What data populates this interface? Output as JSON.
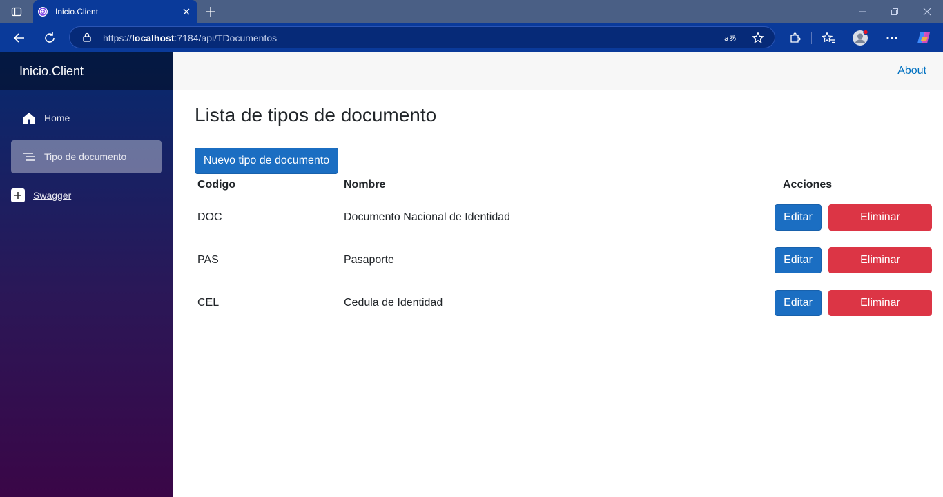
{
  "browser": {
    "tab_title": "Inicio.Client",
    "url_prefix": "https://",
    "url_host": "localhost",
    "url_rest": ":7184/api/TDocumentos",
    "profile_badge_color": "#e81123",
    "accent": "#0a3a9a"
  },
  "app": {
    "brand": "Inicio.Client",
    "nav": [
      {
        "label": "Home",
        "icon": "home-icon"
      },
      {
        "label": "Tipo de documento",
        "icon": "list-icon",
        "active": true
      }
    ],
    "swagger_label": "Swagger",
    "about_label": "About"
  },
  "main": {
    "title": "Lista de tipos de documento",
    "new_button": "Nuevo tipo de documento",
    "columns": {
      "codigo": "Codigo",
      "nombre": "Nombre",
      "acciones": "Acciones"
    },
    "rows": [
      {
        "codigo": "DOC",
        "nombre": "Documento Nacional de Identidad"
      },
      {
        "codigo": "PAS",
        "nombre": "Pasaporte"
      },
      {
        "codigo": "CEL",
        "nombre": "Cedula de Identidad"
      }
    ],
    "edit_label": "Editar",
    "delete_label": "Eliminar"
  },
  "colors": {
    "primary": "#1b6ec2",
    "danger": "#dc3545",
    "link": "#0071c1"
  }
}
